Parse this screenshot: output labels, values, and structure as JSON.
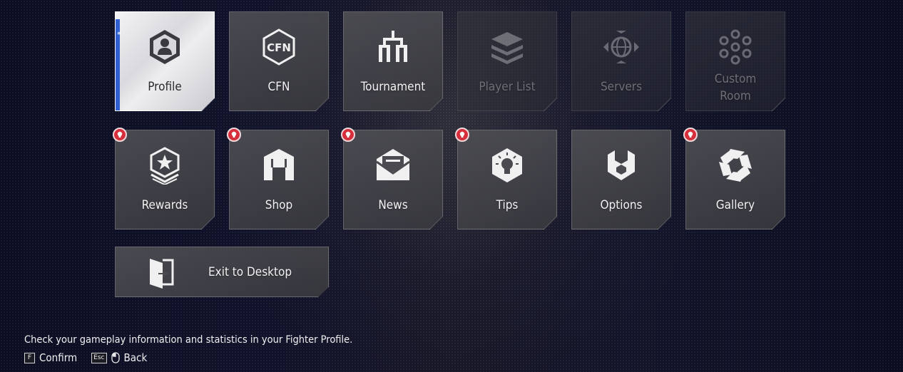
{
  "menu": {
    "row1": [
      {
        "label": "Profile",
        "icon": "profile-hexagon-icon",
        "state": "selected"
      },
      {
        "label": "CFN",
        "icon": "cfn-logo-icon",
        "state": "normal"
      },
      {
        "label": "Tournament",
        "icon": "tournament-bracket-icon",
        "state": "normal"
      },
      {
        "label": "Player List",
        "icon": "stacked-layers-icon",
        "state": "disabled"
      },
      {
        "label": "Servers",
        "icon": "globe-server-icon",
        "state": "disabled"
      },
      {
        "label_line1": "Custom",
        "label_line2": "Room",
        "icon": "hex-cluster-icon",
        "state": "disabled"
      }
    ],
    "row2": [
      {
        "label": "Rewards",
        "icon": "star-medal-icon",
        "notification": true
      },
      {
        "label": "Shop",
        "icon": "shop-icon",
        "notification": true
      },
      {
        "label": "News",
        "icon": "envelope-icon",
        "notification": true
      },
      {
        "label": "Tips",
        "icon": "lightbulb-icon",
        "notification": true
      },
      {
        "label": "Options",
        "icon": "wrench-icon",
        "notification": false
      },
      {
        "label": "Gallery",
        "icon": "aperture-icon",
        "notification": true
      }
    ],
    "exit": {
      "label": "Exit to Desktop",
      "icon": "exit-door-icon"
    }
  },
  "footer": {
    "hint": "Check your gameplay information and statistics in your Fighter Profile.",
    "confirm_key": "F",
    "confirm_label": "Confirm",
    "back_key": "Esc",
    "back_label": "Back"
  },
  "colors": {
    "selection_accent": "#2f5fd0",
    "notification_badge": "#d62e3a"
  }
}
